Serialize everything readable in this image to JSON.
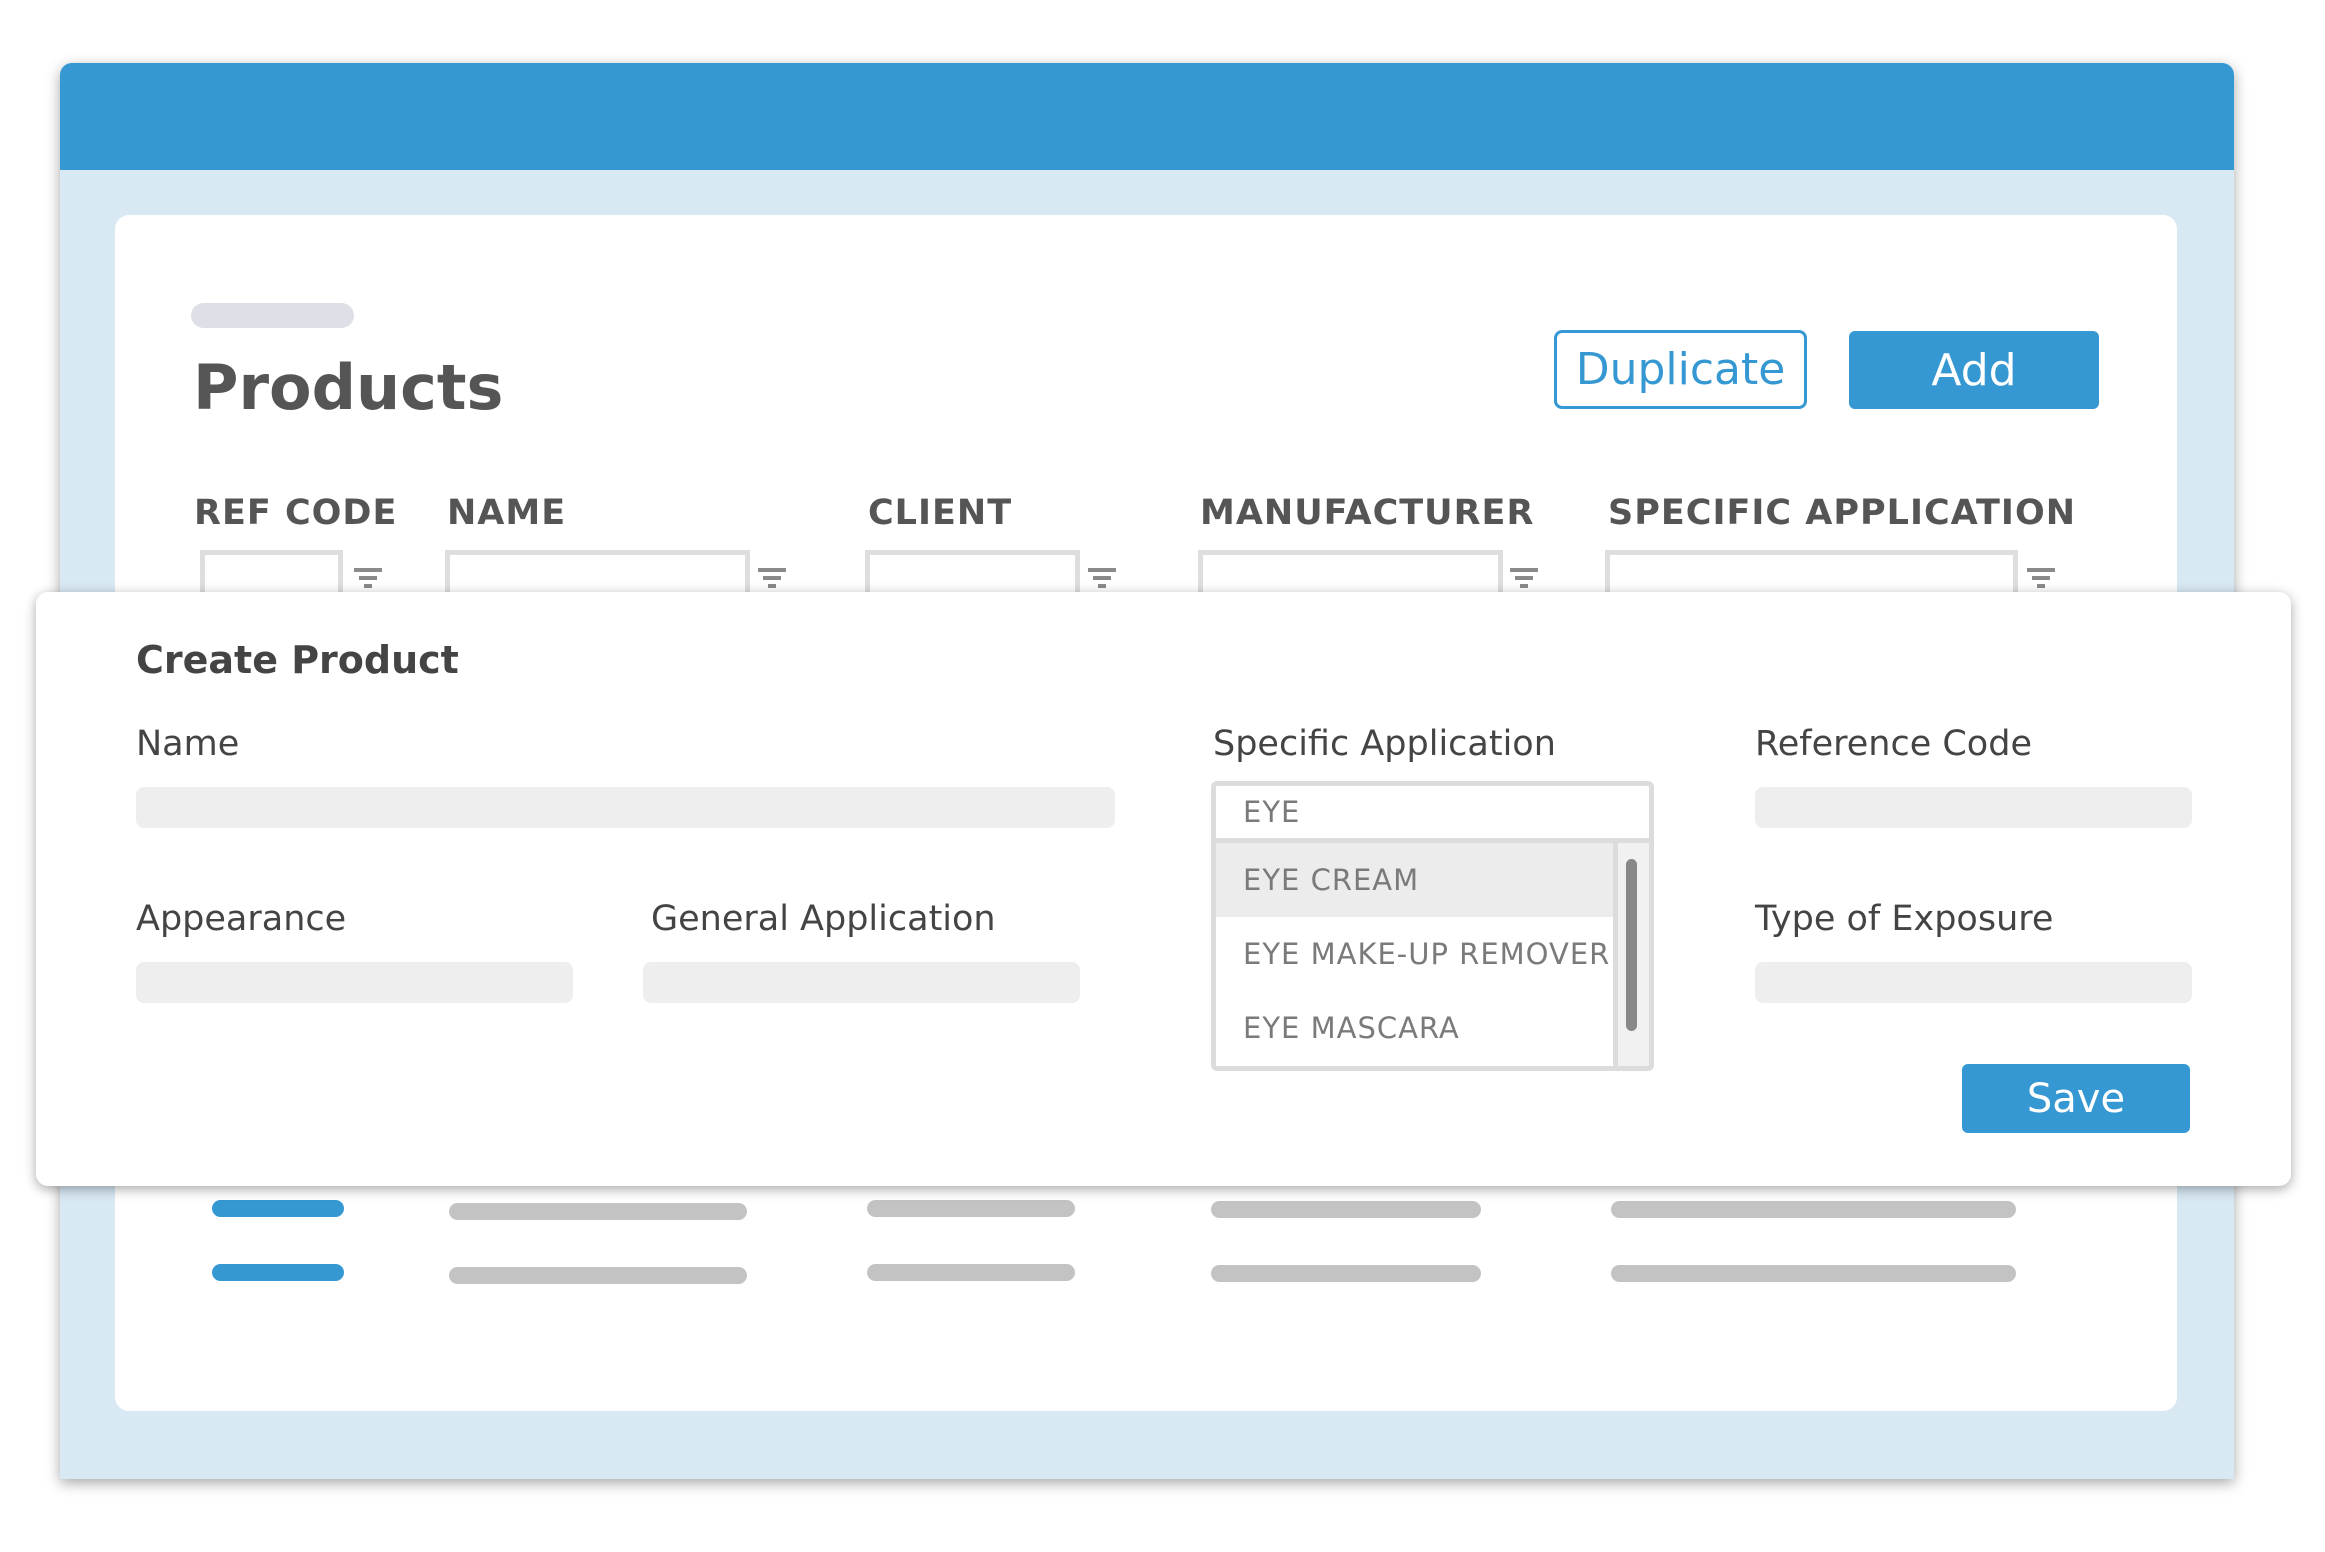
{
  "page": {
    "title": "Products",
    "duplicate_label": "Duplicate",
    "add_label": "Add"
  },
  "table": {
    "columns": [
      "REF CODE",
      "NAME",
      "CLIENT",
      "MANUFACTURER",
      "SPECIFIC APPLICATION"
    ]
  },
  "modal": {
    "title": "Create Product",
    "name_label": "Name",
    "appearance_label": "Appearance",
    "general_application_label": "General Application",
    "specific_application_label": "Specific Application",
    "specific_application_value": "EYE",
    "specific_application_options": [
      "EYE CREAM",
      "EYE MAKE-UP REMOVER",
      "EYE MASCARA"
    ],
    "reference_code_label": "Reference Code",
    "type_of_exposure_label": "Type of Exposure",
    "save_label": "Save"
  },
  "colors": {
    "accent": "#3598d2",
    "window_background": "#d8e9f4",
    "heading_text": "#555555",
    "placeholder_bar": "#c3c3c3"
  }
}
